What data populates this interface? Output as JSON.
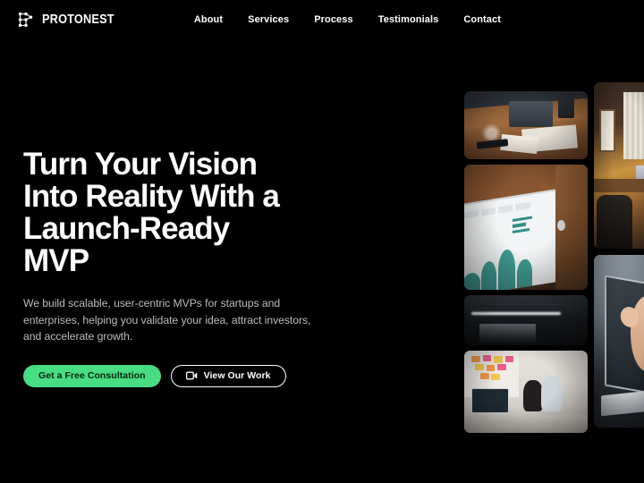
{
  "brand": {
    "name": "PROTONEST",
    "logo_icon": "network-nodes-icon"
  },
  "nav": {
    "items": [
      {
        "label": "About"
      },
      {
        "label": "Services"
      },
      {
        "label": "Process"
      },
      {
        "label": "Testimonials"
      },
      {
        "label": "Contact"
      }
    ]
  },
  "hero": {
    "headline": "Turn Your Vision\nInto Reality With a\nLaunch-Ready\nMVP",
    "subcopy": "We build scalable, user-centric MVPs for startups and\nenterprises, helping you validate your idea, attract investors,\nand accelerate growth.",
    "primary_cta": {
      "label": "Get a Free Consultation"
    },
    "secondary_cta": {
      "label": "View Our Work",
      "icon": "video-camera-icon"
    }
  },
  "collage": {
    "images": [
      {
        "alt": "Desk with laptop, papers and coffee cup"
      },
      {
        "alt": "Laptop showing analytics dashboard with charts"
      },
      {
        "alt": "Dark reflective glass desk surface"
      },
      {
        "alt": "Team meeting in front of sticky-note wall"
      },
      {
        "alt": "Office interior with window and desks"
      },
      {
        "alt": "Hand pointing at a laptop screen"
      }
    ]
  },
  "colors": {
    "background": "#000000",
    "accent_green": "#48dc83",
    "text_primary": "#ffffff",
    "text_secondary": "#b9bdc2"
  }
}
